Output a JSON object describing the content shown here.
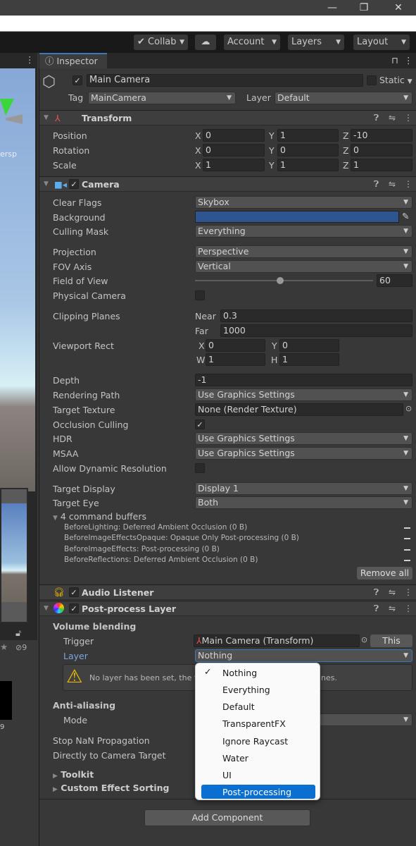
{
  "window": {
    "minimize": "—",
    "maximize": "❐",
    "close": "✕"
  },
  "toolbar": {
    "collab": "Collab",
    "account": "Account",
    "layers": "Layers",
    "layout": "Layout"
  },
  "left": {
    "persp": "ersp",
    "hidden_count": "9",
    "asset_label": "9"
  },
  "inspector": {
    "tab": "Inspector",
    "object_name": "Main Camera",
    "static_label": "Static",
    "tag_label": "Tag",
    "tag": "MainCamera",
    "layer_label": "Layer",
    "layer": "Default"
  },
  "transform": {
    "title": "Transform",
    "rows": [
      {
        "label": "Position",
        "x": "0",
        "y": "1",
        "z": "-10"
      },
      {
        "label": "Rotation",
        "x": "0",
        "y": "0",
        "z": "0"
      },
      {
        "label": "Scale",
        "x": "1",
        "y": "1",
        "z": "1"
      }
    ]
  },
  "camera": {
    "title": "Camera",
    "clear_flags": {
      "label": "Clear Flags",
      "value": "Skybox"
    },
    "background": {
      "label": "Background",
      "color": "#2f5590"
    },
    "culling_mask": {
      "label": "Culling Mask",
      "value": "Everything"
    },
    "projection": {
      "label": "Projection",
      "value": "Perspective"
    },
    "fov_axis": {
      "label": "FOV Axis",
      "value": "Vertical"
    },
    "fov": {
      "label": "Field of View",
      "value": "60",
      "slider_fraction": 0.48
    },
    "physical": {
      "label": "Physical Camera",
      "checked": false
    },
    "clipping": {
      "label": "Clipping Planes",
      "near_label": "Near",
      "near": "0.3",
      "far_label": "Far",
      "far": "1000"
    },
    "viewport": {
      "label": "Viewport Rect",
      "x": "0",
      "y": "0",
      "w": "1",
      "h": "1"
    },
    "depth": {
      "label": "Depth",
      "value": "-1"
    },
    "rendering_path": {
      "label": "Rendering Path",
      "value": "Use Graphics Settings"
    },
    "target_texture": {
      "label": "Target Texture",
      "value": "None (Render Texture)"
    },
    "occlusion": {
      "label": "Occlusion Culling",
      "checked": true
    },
    "hdr": {
      "label": "HDR",
      "value": "Use Graphics Settings"
    },
    "msaa": {
      "label": "MSAA",
      "value": "Use Graphics Settings"
    },
    "dynres": {
      "label": "Allow Dynamic Resolution",
      "checked": false
    },
    "target_display": {
      "label": "Target Display",
      "value": "Display 1"
    },
    "target_eye": {
      "label": "Target Eye",
      "value": "Both"
    },
    "command_buffers": {
      "label": "4 command buffers",
      "items": [
        "BeforeLighting: Deferred Ambient Occlusion (0 B)",
        "BeforeImageEffectsOpaque: Opaque Only Post-processing (0 B)",
        "BeforeImageEffects: Post-processing (0 B)",
        "BeforeReflections: Deferred Ambient Occlusion (0 B)"
      ],
      "remove_all": "Remove all"
    }
  },
  "audio_listener": {
    "title": "Audio Listener"
  },
  "post_process": {
    "title": "Post-process Layer",
    "volume_blending": "Volume blending",
    "trigger_label": "Trigger",
    "trigger": "Main Camera (Transform)",
    "this_button": "This",
    "layer_label": "Layer",
    "layer": "Nothing",
    "warning": "No layer has been set, the tri",
    "warning_tail": "nes.",
    "anti_aliasing": "Anti-aliasing",
    "mode_label": "Mode",
    "stop_nan": "Stop NaN Propagation",
    "direct_target": "Directly to Camera Target",
    "toolkit": "Toolkit",
    "custom_sorting": "Custom Effect Sorting"
  },
  "add_component": "Add Component",
  "layer_menu": {
    "items": [
      "Nothing",
      "Everything",
      "Default",
      "TransparentFX",
      "Ignore Raycast",
      "Water",
      "UI",
      "Post-processing"
    ],
    "checked": "Nothing",
    "highlighted": "Post-processing"
  }
}
